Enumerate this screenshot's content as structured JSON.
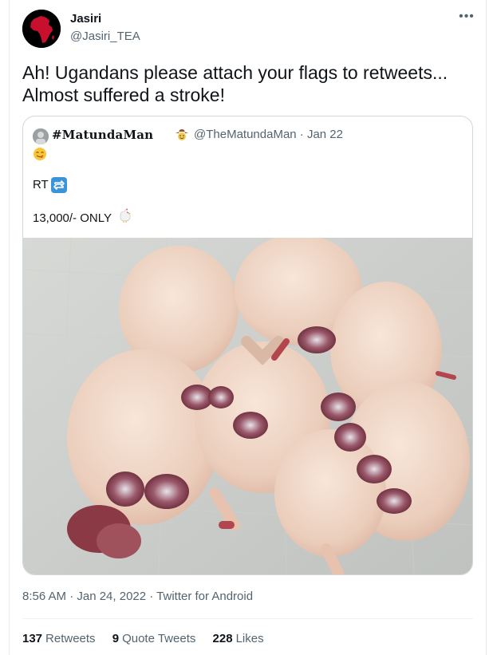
{
  "author": {
    "name": "Jasiri",
    "handle": "@Jasiri_TEA"
  },
  "more_icon": "more-horizontal-icon",
  "tweet": {
    "text": "Ah! Ugandans please attach your flags to retweets...\nAlmost suffered a stroke!"
  },
  "quoted": {
    "name": "#MatundaMan",
    "handle_date": "@TheMatundaMan · Jan 22",
    "line_rt": "RT",
    "line_price": "13,000/- ONLY",
    "icons": [
      "face-savoring-food-emoji",
      "cowboy-emoji",
      "repeat-button-emoji",
      "chicken-emoji"
    ]
  },
  "meta": {
    "text": "8:56 AM · Jan 24, 2022 · Twitter for Android"
  },
  "stats": [
    {
      "count": "137",
      "label": "Retweets"
    },
    {
      "count": "9",
      "label": "Quote Tweets"
    },
    {
      "count": "228",
      "label": "Likes"
    }
  ]
}
